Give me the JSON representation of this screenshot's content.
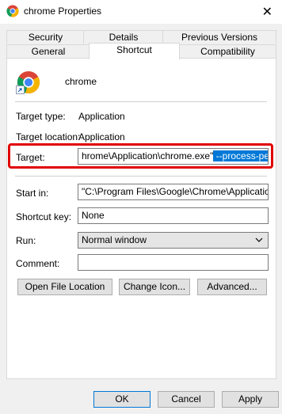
{
  "window": {
    "title": "chrome Properties",
    "close_glyph": "✕",
    "icon": "chrome-icon"
  },
  "tabs": {
    "row1": [
      "Security",
      "Details",
      "Previous Versions"
    ],
    "row2": [
      "General",
      "Shortcut",
      "Compatibility"
    ],
    "active": "Shortcut"
  },
  "shortcut": {
    "app_name": "chrome",
    "target_type_label": "Target type:",
    "target_type_value": "Application",
    "target_location_label": "Target location:",
    "target_location_value": "Application",
    "target_label": "Target:",
    "target_value_plain": "hrome\\Application\\chrome.exe\"",
    "target_value_selected": " --process-per-site",
    "start_in_label": "Start in:",
    "start_in_value": "\"C:\\Program Files\\Google\\Chrome\\Application\"",
    "shortcut_key_label": "Shortcut key:",
    "shortcut_key_value": "None",
    "run_label": "Run:",
    "run_value": "Normal window",
    "comment_label": "Comment:",
    "comment_value": "",
    "open_file_location_label": "Open File Location",
    "change_icon_label": "Change Icon...",
    "advanced_label": "Advanced..."
  },
  "footer": {
    "ok_label": "OK",
    "cancel_label": "Cancel",
    "apply_label": "Apply"
  },
  "colors": {
    "highlight": "#0078d7",
    "annotation_red": "#e00000"
  }
}
